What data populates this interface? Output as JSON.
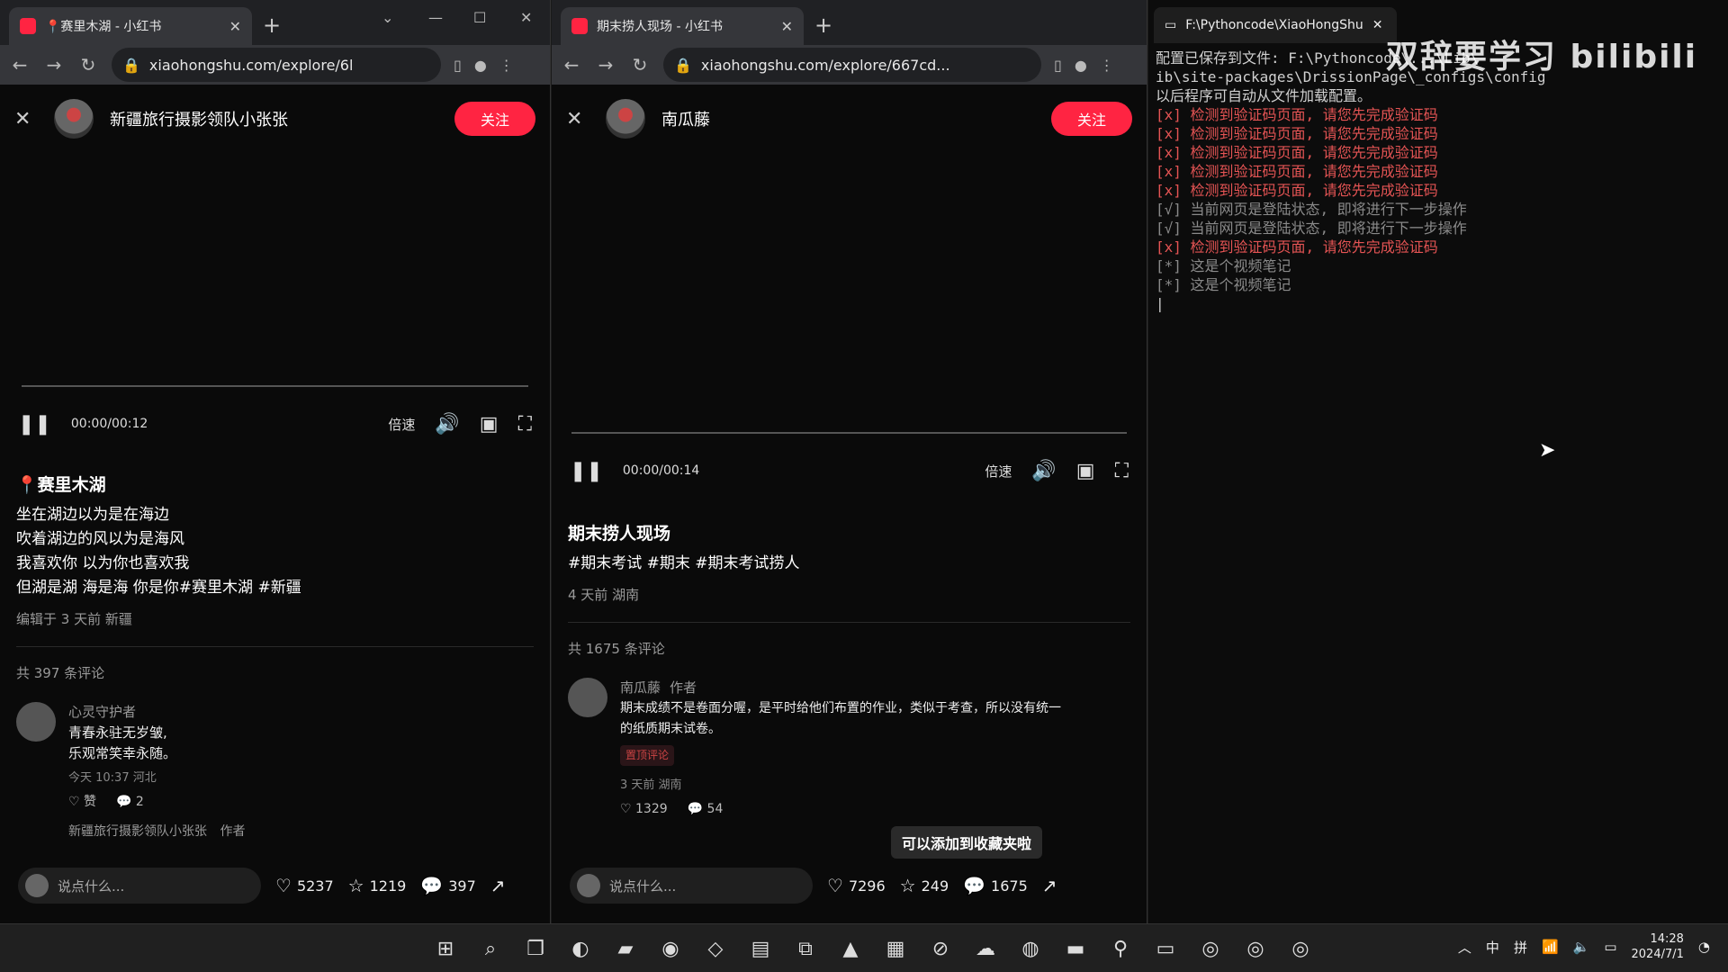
{
  "windows": [
    {
      "tab_title": "📍赛里木湖 - 小红书",
      "url": "xiaohongshu.com/explore/6l",
      "author": "新疆旅行摄影领队小张张",
      "follow_label": "关注",
      "time": "00:00/00:12",
      "speed_label": "倍速",
      "title": "📍赛里木湖",
      "desc_lines": [
        "坐在湖边以为是在海边",
        "吹着湖边的风以为是海风",
        "我喜欢你 以为你也喜欢我",
        "但湖是湖 海是海 你是你#赛里木湖 #新疆"
      ],
      "meta": "编辑于 3 天前 新疆",
      "comment_count": "共 397 条评论",
      "comment": {
        "name": "心灵守护者",
        "tag": "",
        "text1": "青春永驻无岁皱,",
        "text2": "乐观常笑幸永随。",
        "time": "今天 10:37 河北",
        "likes": "赞",
        "replies": "2"
      },
      "next_comment_name": "新疆旅行摄影领队小张张",
      "next_comment_tag": "作者",
      "input_placeholder": "说点什么...",
      "likes": "5237",
      "stars": "1219",
      "comments": "397"
    },
    {
      "tab_title": "期末捞人现场 - 小红书",
      "url": "xiaohongshu.com/explore/667cd...",
      "author": "南瓜藤",
      "follow_label": "关注",
      "time": "00:00/00:14",
      "speed_label": "倍速",
      "title": "期末捞人现场",
      "desc_lines": [
        "#期末考试 #期末 #期末考试捞人"
      ],
      "meta": "4 天前 湖南",
      "comment_count": "共 1675 条评论",
      "comment": {
        "name": "南瓜藤",
        "tag": "作者",
        "text1": "期末成绩不是卷面分喔，是平时给他们布置的作业，类似于考查，所以没有统一",
        "text2": "的纸质期末试卷。",
        "pin": "置顶评论",
        "time": "3 天前 湖南",
        "likes": "1329",
        "replies": "54"
      },
      "input_placeholder": "说点什么...",
      "likes": "7296",
      "stars": "249",
      "comments": "1675",
      "toast": "可以添加到收藏夹啦"
    }
  ],
  "terminal": {
    "tab_title": "F:\\Pythoncode\\XiaoHongShu",
    "lines": [
      {
        "text": "配置已保存到文件: F:\\Pythoncode\\...\\Lib\\",
        "style": "tl"
      },
      {
        "text": "ib\\site-packages\\DrissionPage\\_configs\\config",
        "style": "tl"
      },
      {
        "text": "以后程序可自动从文件加载配置。",
        "style": "tl"
      },
      {
        "text": "[x] 检测到验证码页面, 请您先完成验证码",
        "style": "tl red"
      },
      {
        "text": "[x] 检测到验证码页面, 请您先完成验证码",
        "style": "tl red"
      },
      {
        "text": "[x] 检测到验证码页面, 请您先完成验证码",
        "style": "tl red"
      },
      {
        "text": "[x] 检测到验证码页面, 请您先完成验证码",
        "style": "tl red"
      },
      {
        "text": "[x] 检测到验证码页面, 请您先完成验证码",
        "style": "tl red"
      },
      {
        "text": "[√] 当前网页是登陆状态, 即将进行下一步操作",
        "style": "tl dim"
      },
      {
        "text": "[√] 当前网页是登陆状态, 即将进行下一步操作",
        "style": "tl dim"
      },
      {
        "text": "[x] 检测到验证码页面, 请您先完成验证码",
        "style": "tl red"
      },
      {
        "text": "[*] 这是个视频笔记",
        "style": "tl dim"
      },
      {
        "text": "[*] 这是个视频笔记",
        "style": "tl dim"
      },
      {
        "text": "|",
        "style": "tl"
      }
    ],
    "watermark": "双辞要学习 bilibili"
  },
  "taskbar": {
    "tray_ime1": "中",
    "tray_ime2": "拼",
    "time": "14:28",
    "date": "2024/7/1"
  }
}
